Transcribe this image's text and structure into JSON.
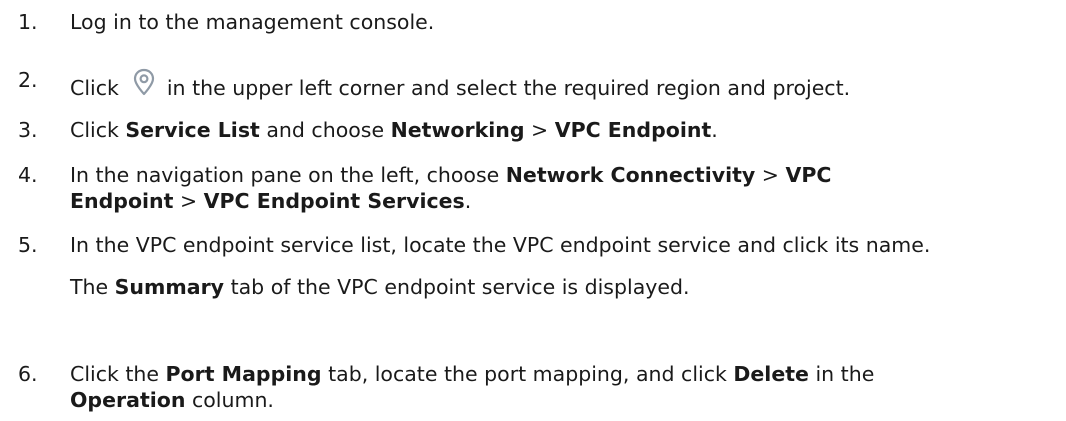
{
  "steps": [
    {
      "number": "1.",
      "text": "Log in to the management console."
    },
    {
      "number": "2.",
      "before_icon": "Click",
      "icon": "location-pin-icon",
      "after_icon": "in the upper left corner and select the required region and project."
    },
    {
      "number": "3.",
      "t1": "Click ",
      "b1": "Service List",
      "t2": " and choose ",
      "b2": "Networking",
      "t3": " > ",
      "b3": "VPC Endpoint",
      "t4": "."
    },
    {
      "number": "4.",
      "t1": "In the navigation pane on the left, choose ",
      "b1": "Network Connectivity",
      "t2": " > ",
      "b2": "VPC Endpoint",
      "t3": " > ",
      "b3": "VPC Endpoint Services",
      "t4": "."
    },
    {
      "number": "5.",
      "text": "In the VPC endpoint service list, locate the VPC endpoint service and click its name.",
      "note_t1": "The ",
      "note_b1": "Summary",
      "note_t2": " tab of the VPC endpoint service is displayed."
    },
    {
      "number": "6.",
      "t1": "Click the ",
      "b1": "Port Mapping",
      "t2": " tab, locate the port mapping, and click ",
      "b2": "Delete",
      "t3": " in the ",
      "b3": "Operation",
      "t4": " column."
    }
  ],
  "colors": {
    "text": "#1a1a1a",
    "icon": "#8f9aa6"
  }
}
